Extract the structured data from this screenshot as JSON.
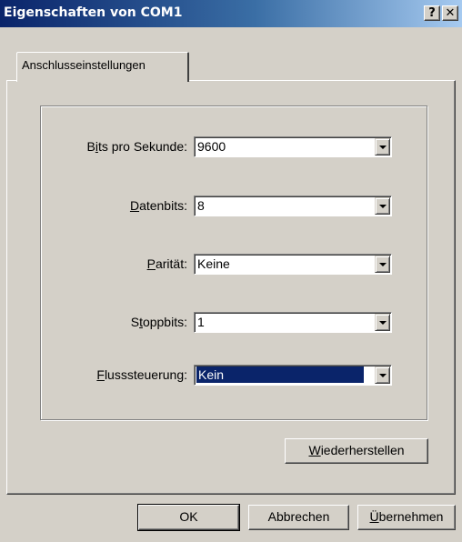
{
  "window": {
    "title": "Eigenschaften von COM1",
    "help_label": "?",
    "close_label": "✕"
  },
  "tabs": [
    {
      "label": "Anschlusseinstellungen"
    }
  ],
  "settings": [
    {
      "label_before": "B",
      "mnemonic": "i",
      "label_after": "ts pro Sekunde:",
      "value": "9600"
    },
    {
      "label_before": "",
      "mnemonic": "D",
      "label_after": "atenbits:",
      "value": "8"
    },
    {
      "label_before": "",
      "mnemonic": "P",
      "label_after": "arität:",
      "value": "Keine"
    },
    {
      "label_before": "S",
      "mnemonic": "t",
      "label_after": "oppbits:",
      "value": "1"
    },
    {
      "label_before": "",
      "mnemonic": "F",
      "label_after": "lusssteuerung:",
      "value": "Kein",
      "selected": true
    }
  ],
  "restore_button": {
    "mnemonic": "W",
    "label_after": "iederherstellen"
  },
  "footer": {
    "ok_label": "OK",
    "cancel_label": "Abbrechen",
    "apply_mnemonic": "Ü",
    "apply_label_after": "bernehmen"
  }
}
